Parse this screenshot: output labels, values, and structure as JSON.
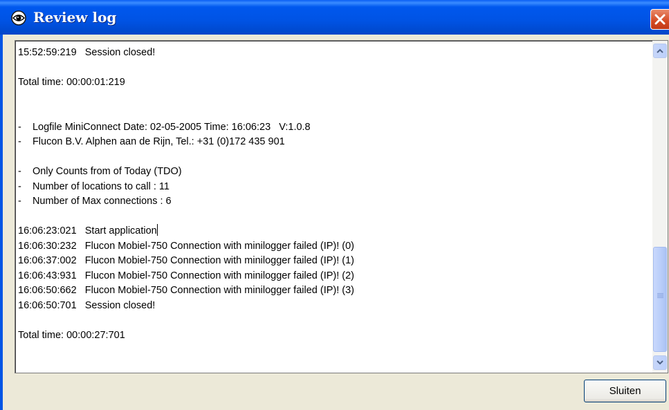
{
  "window": {
    "title": "Review log",
    "icons": {
      "title": "eye-icon",
      "close": "close-icon"
    },
    "colors": {
      "titlebar": "#0054e3",
      "close": "#d4502a"
    }
  },
  "log": {
    "lines": [
      "15:52:59:219   Session closed!",
      "",
      "Total time: 00:00:01:219",
      "",
      "",
      "-    Logfile MiniConnect Date: 02-05-2005 Time: 16:06:23   V:1.0.8",
      "-    Flucon B.V. Alphen aan de Rijn, Tel.: +31 (0)172 435 901",
      "",
      "-    Only Counts from of Today (TDO)",
      "-    Number of locations to call : 11",
      "-    Number of Max connections : 6",
      "",
      "16:06:23:021   Start application",
      "16:06:30:232   Flucon Mobiel-750 Connection with minilogger failed (IP)! (0)",
      "16:06:37:002   Flucon Mobiel-750 Connection with minilogger failed (IP)! (1)",
      "16:06:43:931   Flucon Mobiel-750 Connection with minilogger failed (IP)! (2)",
      "16:06:50:662   Flucon Mobiel-750 Connection with minilogger failed (IP)! (3)",
      "16:06:50:701   Session closed!",
      "",
      "Total time: 00:00:27:701"
    ]
  },
  "buttons": {
    "close_label": "Sluiten"
  }
}
